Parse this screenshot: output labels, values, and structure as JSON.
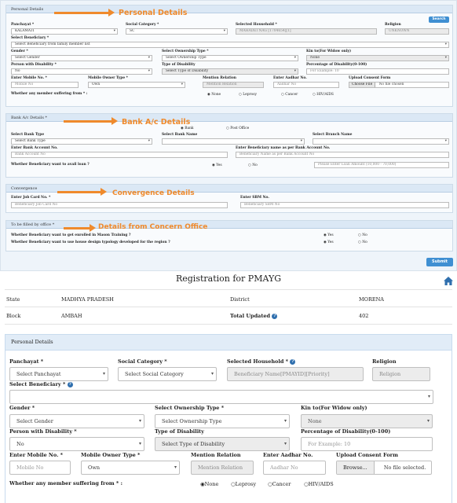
{
  "top": {
    "personal": {
      "header": "Personal Details",
      "annotation": "Personal Details",
      "search_button": "Search",
      "labels": {
        "panchayat": "Panchayat *",
        "social_category": "Social Category *",
        "selected_household": "Selected Household *",
        "religion": "Religion",
        "select_beneficiary": "Select Beneficiary *",
        "gender": "Gender *",
        "ownership_type": "Select Ownership Type *",
        "kin": "Kin to(For Widow only)",
        "disability": "Person with Disability *",
        "type_disability": "Type of Disability",
        "pct_disability": "Percentage of Disability(0-100)",
        "mobile": "Enter Mobile No. *",
        "mobile_owner": "Mobile Owner Type *",
        "mention_relation": "Mention Relation",
        "aadhar": "Enter Aadhar No.",
        "consent": "Upload Consent Form",
        "suffering": "Whether any member suffering from * :"
      },
      "values": {
        "panchayat": "KALAMATI",
        "social_category": "SC",
        "selected_household": "MAHADEI NAG [1704654][1]",
        "religion": "UNKNOWN",
        "select_beneficiary": "Select Beneficiary from family member list",
        "gender": "Select Gender",
        "ownership_type": "Select Ownership Type",
        "kin": "None",
        "disability": "No",
        "type_disability": "Select Type of Disability",
        "pct_disability": "For Example: 10",
        "mobile": "Mobile No",
        "mobile_owner": "Own",
        "mention_relation": "Mention Relation",
        "aadhar": "Aadhar No",
        "browse": "Choose File",
        "file": "No file chosen"
      },
      "suffering_options": [
        "None",
        "Leprosy",
        "Cancer",
        "HIV/AIDS"
      ]
    },
    "bank": {
      "header": "Bank A/c Details *",
      "annotation": "Bank A/c Details",
      "options": [
        "Bank",
        "Post Office"
      ],
      "labels": {
        "bank_type": "Select Bank Type",
        "bank_name": "Select Bank Name",
        "branch_name": "Select Branch Name",
        "account_no": "Enter Bank Account No.",
        "beneficiary_name": "Enter Beneficiary name as per Bank Account No.",
        "avail_loan": "Whether Beneficiary want to avail loan ?"
      },
      "values": {
        "bank_type": "Select Bank Type",
        "account_no": "Bank Account No",
        "beneficiary_name": "Beneficiary Name as per Bank Account No",
        "loan_amount": "Please Enter Loan Amount (10,000 - 70,000)"
      },
      "loan_options": [
        "Yes",
        "No"
      ]
    },
    "convergence": {
      "header": "Convergence",
      "annotation": "Convergence Details",
      "labels": {
        "job_card": "Enter Job Card No. *",
        "sbm": "Enter SBM No."
      },
      "values": {
        "job_card": "Beneficiary Job Card No",
        "sbm": "Beneficiary SBM No"
      }
    },
    "office": {
      "header": "To be filled by office *",
      "annotation": "Details from Concern Office",
      "q1": "Whether Beneficiary want to get enrolled in Mason Training ?",
      "q2": "Whether Beneficiary want to use house design typology developed for the region ?",
      "options": [
        "Yes",
        "No"
      ]
    },
    "submit": "Submit"
  },
  "form": {
    "title": "Registration for PMAYG",
    "home_icon": "home-icon",
    "summary": {
      "state_label": "State",
      "state_value": "MADHYA PRADESH",
      "district_label": "District",
      "district_value": "MORENA",
      "block_label": "Block",
      "block_value": "AMBAH",
      "total_label": "Total Updated",
      "total_value": "402"
    },
    "section_header": "Personal Details",
    "labels": {
      "panchayat": "Panchayat *",
      "social_category": "Social Category *",
      "selected_household": "Selected Household *",
      "religion": "Religion",
      "select_beneficiary": "Select Beneficiary *",
      "gender": "Gender *",
      "ownership_type": "Select Ownership Type *",
      "kin": "Kin to(For Widow only)",
      "disability": "Person with Disability *",
      "type_disability": "Type of Disability",
      "pct_disability": "Percentage of Disability(0-100)",
      "mobile": "Enter Mobile No. *",
      "mobile_owner": "Mobile Owner Type *",
      "mention_relation": "Mention Relation",
      "aadhar": "Enter Aadhar No.",
      "consent": "Upload Consent Form",
      "suffering": "Whether any member suffering from * :"
    },
    "values": {
      "panchayat": "Select Panchayat",
      "social_category": "Select Social Category",
      "selected_household": "Beneficiary Name[PMAYID][Priority]",
      "religion": "Religion",
      "select_beneficiary": "",
      "gender": "Select Gender",
      "ownership_type": "Select Ownership Type",
      "kin": "None",
      "disability": "No",
      "type_disability": "Select Type of Disability",
      "pct_disability": "For Example: 10",
      "mobile": "Mobile No",
      "mobile_owner": "Own",
      "mention_relation": "Mention Relation",
      "aadhar": "Aadhar No",
      "browse": "Browse...",
      "file": "No file selected."
    },
    "suffering_options": [
      "None",
      "Leprosy",
      "Cancer",
      "HIV/AIDS"
    ]
  }
}
